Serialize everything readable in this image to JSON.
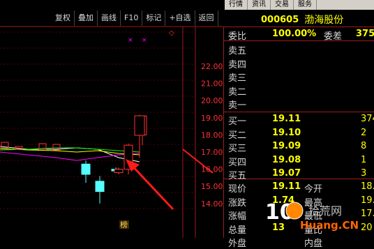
{
  "topmenu": [
    "行情",
    "资讯",
    "交易",
    "服务"
  ],
  "toolbar": [
    "复权",
    "叠加",
    "画线",
    "F10",
    "标记",
    "+自选",
    "返回"
  ],
  "stock": {
    "code": "000605",
    "name": "渤海股份"
  },
  "weibi": {
    "label": "委比",
    "value": "100.00%",
    "diff_label": "委差",
    "diff": "3751"
  },
  "sell": [
    {
      "label": "卖五",
      "price": "",
      "vol": ""
    },
    {
      "label": "卖四",
      "price": "",
      "vol": ""
    },
    {
      "label": "卖三",
      "price": "",
      "vol": ""
    },
    {
      "label": "卖二",
      "price": "",
      "vol": ""
    },
    {
      "label": "卖一",
      "price": "",
      "vol": ""
    }
  ],
  "buy": [
    {
      "label": "买一",
      "price": "19.11",
      "vol": "3740"
    },
    {
      "label": "买二",
      "price": "19.10",
      "vol": "2"
    },
    {
      "label": "买三",
      "price": "19.09",
      "vol": "8"
    },
    {
      "label": "买四",
      "price": "19.08",
      "vol": "1"
    },
    {
      "label": "买五",
      "price": "19.07",
      "vol": "3"
    }
  ],
  "quote": [
    {
      "l": "现价",
      "v": "19.11",
      "l2": "今开",
      "v2": "18.0"
    },
    {
      "l": "涨跌",
      "v": "1.74",
      "l2": "最高",
      "v2": "19.1"
    },
    {
      "l": "涨幅",
      "v": "",
      "l2": "最低",
      "v2": "17.3"
    },
    {
      "l": "总量",
      "v": "13",
      "l2": "量比",
      "v2": "20"
    },
    {
      "l": "外盘",
      "v": "",
      "l2": "内盘",
      "v2": ""
    }
  ],
  "y_axis": [
    "22.00",
    "21.00",
    "20.00",
    "19.00",
    "18.00",
    "17.00",
    "16.00",
    "15.00",
    "14.00"
  ],
  "bottom_tag": "榜",
  "markers": [
    "×",
    "×"
  ],
  "watermark": {
    "line1": "拾荒网",
    "line2": "Huang.CN",
    "digit": "10"
  },
  "candles": [
    {
      "o": 17.6,
      "c": 18.3,
      "h": 18.4,
      "l": 17.6,
      "up": true
    },
    {
      "o": 16.3,
      "c": 15.7,
      "h": 16.5,
      "l": 15.2,
      "up": false
    },
    {
      "o": 15.3,
      "c": 14.7,
      "h": 15.6,
      "l": 14.0,
      "up": false
    },
    {
      "o": 15.9,
      "c": 16.0,
      "h": 16.1,
      "l": 15.8,
      "up": false
    },
    {
      "o": 15.8,
      "c": 16.0,
      "h": 16.1,
      "l": 15.7,
      "up": true
    },
    {
      "o": 16.0,
      "c": 17.4,
      "h": 17.5,
      "l": 15.7,
      "up": true
    },
    {
      "o": 18.0,
      "c": 19.1,
      "h": 19.1,
      "l": 17.4,
      "up": true
    }
  ],
  "colors": {
    "up": "#ff3232",
    "down": "#54ffff",
    "bg": "#000000",
    "ma5": "#ffffff",
    "ma10": "#ffff00",
    "ma20": "#ff00ff",
    "ma30": "#00ff00",
    "arrow": "#ff1a1a"
  }
}
